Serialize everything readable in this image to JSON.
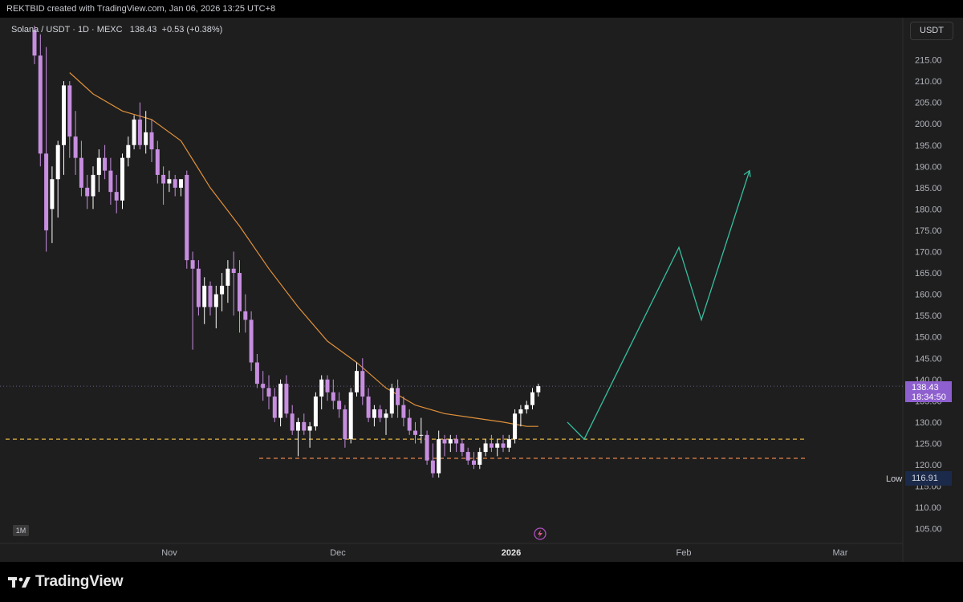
{
  "header": {
    "created_text": "REKTBID created with TradingView.com, Jan 06, 2026 13:25 UTC+8"
  },
  "legend": {
    "symbol": "Solana / USDT · 1D · MEXC",
    "last": "138.43",
    "change": "+0.53 (+0.38%)"
  },
  "toolbar": {
    "currency_label": "USDT",
    "interval_badge": "1M"
  },
  "price_scale": {
    "ticks": [
      "215.00",
      "210.00",
      "205.00",
      "200.00",
      "195.00",
      "190.00",
      "185.00",
      "180.00",
      "175.00",
      "170.00",
      "165.00",
      "160.00",
      "155.00",
      "150.00",
      "145.00",
      "140.00",
      "135.00",
      "130.00",
      "125.00",
      "120.00",
      "115.00",
      "110.00",
      "105.00"
    ],
    "current_price": "138.43",
    "countdown": "18:34:50",
    "low_label": "Low",
    "low_value": "116.91"
  },
  "time_scale": {
    "labels": [
      "Nov",
      "Dec",
      "2026",
      "Feb",
      "Mar"
    ]
  },
  "colors": {
    "up": "#ffffff",
    "down": "#c78ee0",
    "ma": "#e0913a",
    "projection": "#35c0a0",
    "support_yellow": "#e3b341",
    "support_orange": "#e8844a",
    "accent": "#8e5fcf"
  },
  "footer": {
    "brand": "TradingView"
  },
  "chart_data": {
    "type": "candlestick",
    "symbol": "Solana / USDT",
    "interval": "1D",
    "exchange": "MEXC",
    "y_range": [
      103,
      221
    ],
    "candles": [
      {
        "o": 222,
        "h": 223,
        "l": 214,
        "c": 216
      },
      {
        "o": 216,
        "h": 221,
        "l": 190,
        "c": 193
      },
      {
        "o": 193,
        "h": 218,
        "l": 170,
        "c": 175
      },
      {
        "o": 180,
        "h": 190,
        "l": 172,
        "c": 187
      },
      {
        "o": 187,
        "h": 196,
        "l": 178,
        "c": 195
      },
      {
        "o": 195,
        "h": 210,
        "l": 188,
        "c": 209
      },
      {
        "o": 209,
        "h": 210,
        "l": 192,
        "c": 197
      },
      {
        "o": 197,
        "h": 203,
        "l": 188,
        "c": 192
      },
      {
        "o": 192,
        "h": 196,
        "l": 183,
        "c": 185
      },
      {
        "o": 185,
        "h": 188,
        "l": 180,
        "c": 183
      },
      {
        "o": 183,
        "h": 190,
        "l": 180,
        "c": 188
      },
      {
        "o": 188,
        "h": 194,
        "l": 184,
        "c": 192
      },
      {
        "o": 192,
        "h": 195,
        "l": 187,
        "c": 189
      },
      {
        "o": 189,
        "h": 192,
        "l": 181,
        "c": 184
      },
      {
        "o": 184,
        "h": 188,
        "l": 179,
        "c": 182
      },
      {
        "o": 182,
        "h": 193,
        "l": 180,
        "c": 192
      },
      {
        "o": 192,
        "h": 197,
        "l": 190,
        "c": 195
      },
      {
        "o": 195,
        "h": 202,
        "l": 194,
        "c": 201
      },
      {
        "o": 201,
        "h": 205,
        "l": 194,
        "c": 195
      },
      {
        "o": 195,
        "h": 203,
        "l": 193,
        "c": 198
      },
      {
        "o": 198,
        "h": 201,
        "l": 191,
        "c": 194
      },
      {
        "o": 194,
        "h": 196,
        "l": 186,
        "c": 188
      },
      {
        "o": 188,
        "h": 190,
        "l": 181,
        "c": 186
      },
      {
        "o": 186,
        "h": 189,
        "l": 184,
        "c": 187
      },
      {
        "o": 187,
        "h": 188,
        "l": 183,
        "c": 185
      },
      {
        "o": 185,
        "h": 187,
        "l": 183,
        "c": 187
      },
      {
        "o": 188,
        "h": 189,
        "l": 166,
        "c": 168
      },
      {
        "o": 168,
        "h": 170,
        "l": 147,
        "c": 166
      },
      {
        "o": 166,
        "h": 168,
        "l": 155,
        "c": 157
      },
      {
        "o": 157,
        "h": 164,
        "l": 153,
        "c": 162
      },
      {
        "o": 162,
        "h": 163,
        "l": 155,
        "c": 157
      },
      {
        "o": 157,
        "h": 162,
        "l": 152,
        "c": 160
      },
      {
        "o": 160,
        "h": 165,
        "l": 156,
        "c": 162
      },
      {
        "o": 162,
        "h": 168,
        "l": 158,
        "c": 166
      },
      {
        "o": 166,
        "h": 170,
        "l": 155,
        "c": 165
      },
      {
        "o": 165,
        "h": 168,
        "l": 151,
        "c": 156
      },
      {
        "o": 156,
        "h": 160,
        "l": 151,
        "c": 154
      },
      {
        "o": 154,
        "h": 156,
        "l": 142,
        "c": 144
      },
      {
        "o": 144,
        "h": 146,
        "l": 138,
        "c": 139
      },
      {
        "o": 139,
        "h": 142,
        "l": 135,
        "c": 138
      },
      {
        "o": 138,
        "h": 141,
        "l": 133,
        "c": 136
      },
      {
        "o": 136,
        "h": 138,
        "l": 130,
        "c": 131
      },
      {
        "o": 131,
        "h": 140,
        "l": 129,
        "c": 139
      },
      {
        "o": 139,
        "h": 141,
        "l": 131,
        "c": 132
      },
      {
        "o": 132,
        "h": 134,
        "l": 127,
        "c": 128
      },
      {
        "o": 128,
        "h": 131,
        "l": 122,
        "c": 130
      },
      {
        "o": 130,
        "h": 132,
        "l": 127,
        "c": 128
      },
      {
        "o": 128,
        "h": 130,
        "l": 124,
        "c": 129
      },
      {
        "o": 129,
        "h": 137,
        "l": 128,
        "c": 136
      },
      {
        "o": 136,
        "h": 141,
        "l": 133,
        "c": 140
      },
      {
        "o": 140,
        "h": 141,
        "l": 135,
        "c": 137
      },
      {
        "o": 137,
        "h": 140,
        "l": 133,
        "c": 135
      },
      {
        "o": 135,
        "h": 137,
        "l": 131,
        "c": 133
      },
      {
        "o": 133,
        "h": 134,
        "l": 124,
        "c": 126
      },
      {
        "o": 126,
        "h": 138,
        "l": 125,
        "c": 137
      },
      {
        "o": 137,
        "h": 144,
        "l": 136,
        "c": 142
      },
      {
        "o": 142,
        "h": 145,
        "l": 134,
        "c": 136
      },
      {
        "o": 136,
        "h": 138,
        "l": 130,
        "c": 131
      },
      {
        "o": 131,
        "h": 134,
        "l": 129,
        "c": 133
      },
      {
        "o": 133,
        "h": 134,
        "l": 130,
        "c": 131
      },
      {
        "o": 131,
        "h": 133,
        "l": 127,
        "c": 132
      },
      {
        "o": 132,
        "h": 139,
        "l": 131,
        "c": 138
      },
      {
        "o": 138,
        "h": 140,
        "l": 131,
        "c": 134
      },
      {
        "o": 134,
        "h": 136,
        "l": 129,
        "c": 131
      },
      {
        "o": 131,
        "h": 133,
        "l": 127,
        "c": 128
      },
      {
        "o": 128,
        "h": 130,
        "l": 125,
        "c": 127
      },
      {
        "o": 127,
        "h": 131,
        "l": 125,
        "c": 127
      },
      {
        "o": 127,
        "h": 128,
        "l": 120,
        "c": 121
      },
      {
        "o": 121,
        "h": 125,
        "l": 117,
        "c": 118
      },
      {
        "o": 118,
        "h": 128,
        "l": 117,
        "c": 126
      },
      {
        "o": 126,
        "h": 127,
        "l": 122,
        "c": 125
      },
      {
        "o": 125,
        "h": 127,
        "l": 123,
        "c": 126
      },
      {
        "o": 126,
        "h": 127,
        "l": 123,
        "c": 125
      },
      {
        "o": 125,
        "h": 126,
        "l": 122,
        "c": 123
      },
      {
        "o": 123,
        "h": 124,
        "l": 120,
        "c": 121
      },
      {
        "o": 121,
        "h": 123,
        "l": 119,
        "c": 120
      },
      {
        "o": 120,
        "h": 124,
        "l": 119,
        "c": 123
      },
      {
        "o": 123,
        "h": 126,
        "l": 122,
        "c": 125
      },
      {
        "o": 125,
        "h": 127,
        "l": 123,
        "c": 124
      },
      {
        "o": 124,
        "h": 126,
        "l": 122,
        "c": 125
      },
      {
        "o": 125,
        "h": 127,
        "l": 123,
        "c": 124
      },
      {
        "o": 124,
        "h": 127,
        "l": 123,
        "c": 126
      },
      {
        "o": 126,
        "h": 133,
        "l": 125,
        "c": 132
      },
      {
        "o": 132,
        "h": 134,
        "l": 129,
        "c": 133
      },
      {
        "o": 133,
        "h": 135,
        "l": 132,
        "c": 134
      },
      {
        "o": 134,
        "h": 138,
        "l": 133,
        "c": 137
      },
      {
        "o": 137,
        "h": 139,
        "l": 136,
        "c": 138.43
      }
    ],
    "moving_average": [
      {
        "i": 6,
        "v": 212
      },
      {
        "i": 10,
        "v": 207
      },
      {
        "i": 15,
        "v": 203
      },
      {
        "i": 20,
        "v": 201
      },
      {
        "i": 25,
        "v": 196
      },
      {
        "i": 30,
        "v": 185
      },
      {
        "i": 35,
        "v": 176
      },
      {
        "i": 40,
        "v": 166
      },
      {
        "i": 45,
        "v": 157
      },
      {
        "i": 50,
        "v": 149
      },
      {
        "i": 55,
        "v": 144
      },
      {
        "i": 60,
        "v": 138
      },
      {
        "i": 65,
        "v": 134
      },
      {
        "i": 70,
        "v": 132
      },
      {
        "i": 75,
        "v": 131
      },
      {
        "i": 80,
        "v": 130
      },
      {
        "i": 84,
        "v": 129
      },
      {
        "i": 86,
        "v": 129
      }
    ],
    "support_levels": [
      {
        "price": 126.0,
        "style": "dashed",
        "color": "yellow"
      },
      {
        "price": 121.5,
        "style": "dashed",
        "color": "orange"
      }
    ],
    "projection_path": [
      {
        "t": "early Jan",
        "v": 130
      },
      {
        "t": "mid Jan",
        "v": 126
      },
      {
        "t": "late Jan",
        "v": 171
      },
      {
        "t": "early Feb",
        "v": 154
      },
      {
        "t": "mid Feb",
        "v": 189
      }
    ]
  }
}
